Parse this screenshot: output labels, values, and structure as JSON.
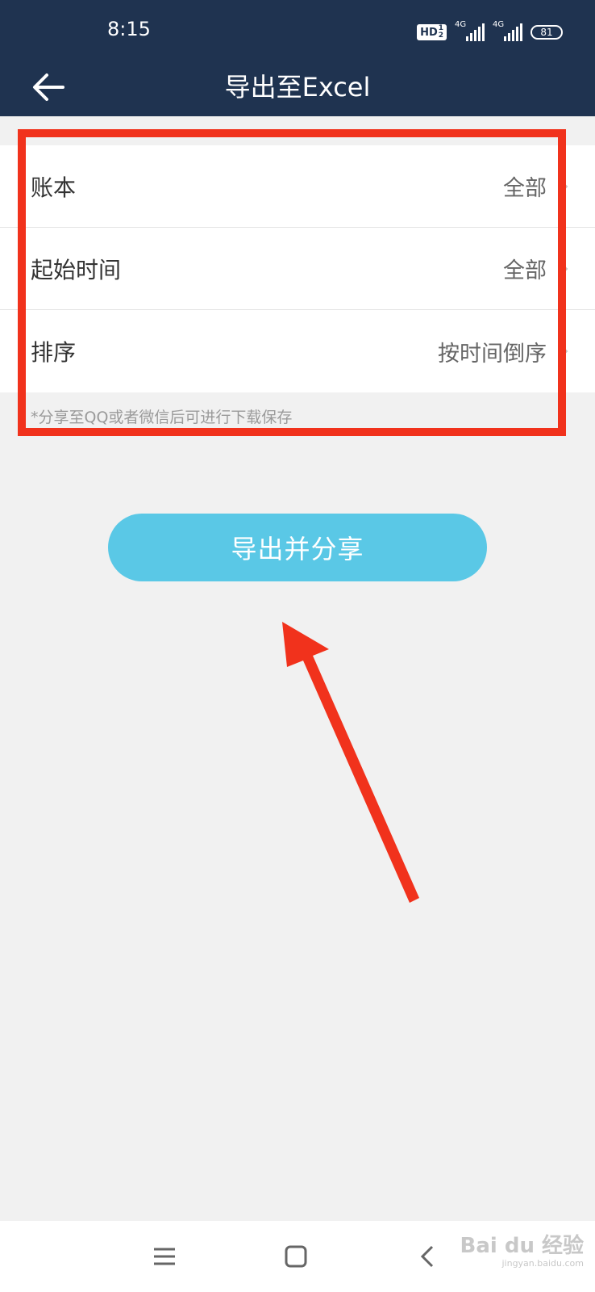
{
  "status_bar": {
    "time": "8:15",
    "hd": "HD",
    "hd_sub": [
      "1",
      "2"
    ],
    "signal_labels": [
      "4G",
      "4G"
    ],
    "battery": "81"
  },
  "header": {
    "title": "导出至Excel",
    "back_icon": "back-arrow-icon"
  },
  "settings": {
    "rows": [
      {
        "label": "账本",
        "value": "全部"
      },
      {
        "label": "起始时间",
        "value": "全部"
      },
      {
        "label": "排序",
        "value": "按时间倒序"
      }
    ]
  },
  "hint": "*分享至QQ或者微信后可进行下载保存",
  "export_button": {
    "label": "导出并分享"
  },
  "annotation": {
    "highlight_color": "#f1321c",
    "arrow_color": "#f1321c"
  },
  "watermark": {
    "text": "Bai du 经验",
    "sub": "jingyan.baidu.com"
  },
  "colors": {
    "header_bg": "#1f3350",
    "button_bg": "#5ac8e6",
    "page_bg": "#f1f1f1"
  }
}
